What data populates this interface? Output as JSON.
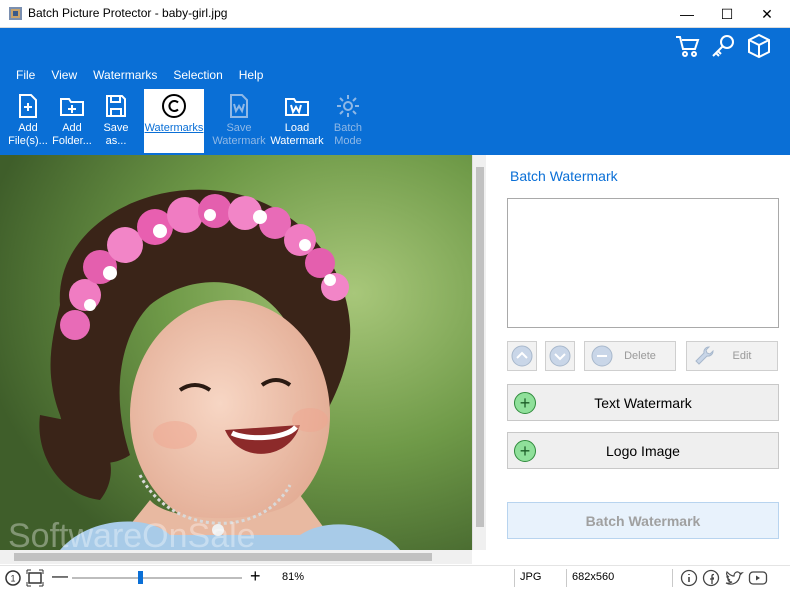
{
  "window": {
    "title": "Batch Picture Protector - baby-girl.jpg",
    "minimize": "—",
    "maximize": "☐",
    "close": "✕"
  },
  "top_icons": [
    "cart-icon",
    "key-icon",
    "box-icon"
  ],
  "menu": [
    "File",
    "View",
    "Watermarks",
    "Selection",
    "Help"
  ],
  "toolbar": {
    "add_files": "Add File(s)...",
    "add_folder": "Add Folder...",
    "save_as": "Save as...",
    "watermarks": "Watermarks",
    "save_watermark": "Save Watermark",
    "load_watermark": "Load Watermark",
    "batch_mode": "Batch Mode"
  },
  "panel": {
    "title": "Batch Watermark",
    "delete_label": "Delete",
    "edit_label": "Edit",
    "text_watermark_label": "Text Watermark",
    "logo_image_label": "Logo Image",
    "batch_watermark_button": "Batch Watermark"
  },
  "status": {
    "zoom": "81%",
    "format": "JPG",
    "dimensions": "682x560",
    "zoom_slider_fraction": 0.81
  },
  "watermark_overlay": "SoftwareOnSale",
  "colors": {
    "accent": "#0a6fd6",
    "ribbon": "#0a6fd6",
    "plus_green": "#8fe09a"
  }
}
